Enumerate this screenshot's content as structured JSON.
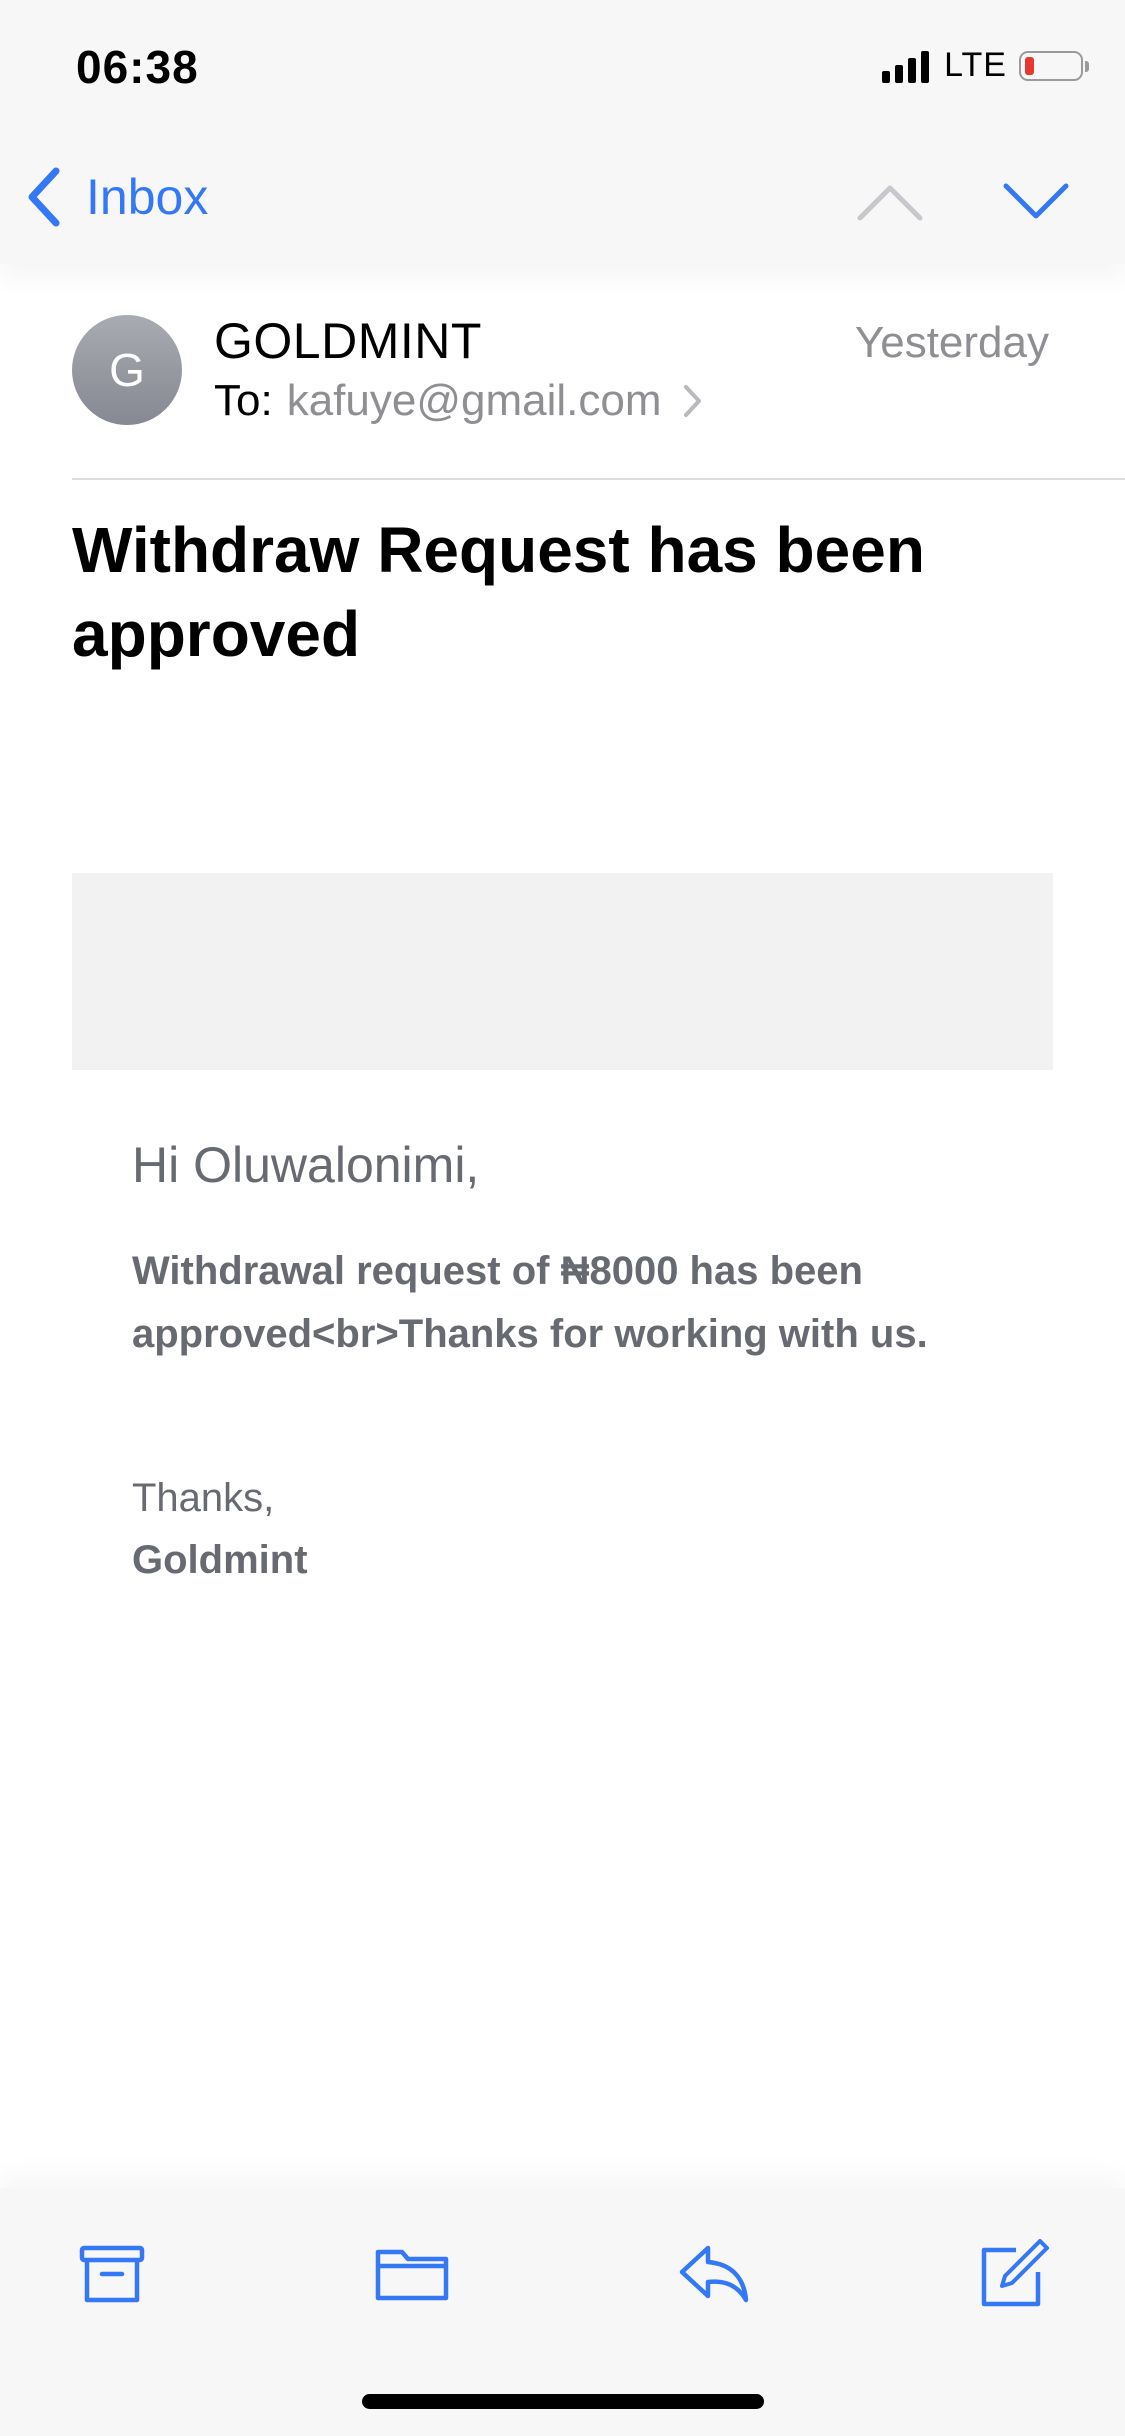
{
  "status_bar": {
    "time": "06:38",
    "network": "LTE",
    "signal_bars": 4,
    "battery_level_percent": 10,
    "battery_color": "#e5392f"
  },
  "nav": {
    "back_label": "Inbox",
    "back_icon": "chevron-left-icon",
    "prev_icon": "chevron-up-icon",
    "next_icon": "chevron-down-icon",
    "accent_color": "#3478f6"
  },
  "email": {
    "avatar_initial": "G",
    "sender": "GOLDMINT",
    "date": "Yesterday",
    "to_label": "To:",
    "to_address": "kafuye@gmail.com",
    "subject": "Withdraw Request has been approved",
    "body": {
      "greeting": "Hi Oluwalonimi,",
      "message": "Withdrawal request of ₦8000 has been approved<br>Thanks for working with us.",
      "thanks": "Thanks,",
      "signature": "Goldmint"
    }
  },
  "toolbar": {
    "items": [
      {
        "name": "archive",
        "icon": "archive-icon"
      },
      {
        "name": "move-to-folder",
        "icon": "folder-icon"
      },
      {
        "name": "reply",
        "icon": "reply-icon"
      },
      {
        "name": "compose",
        "icon": "compose-icon"
      }
    ]
  }
}
